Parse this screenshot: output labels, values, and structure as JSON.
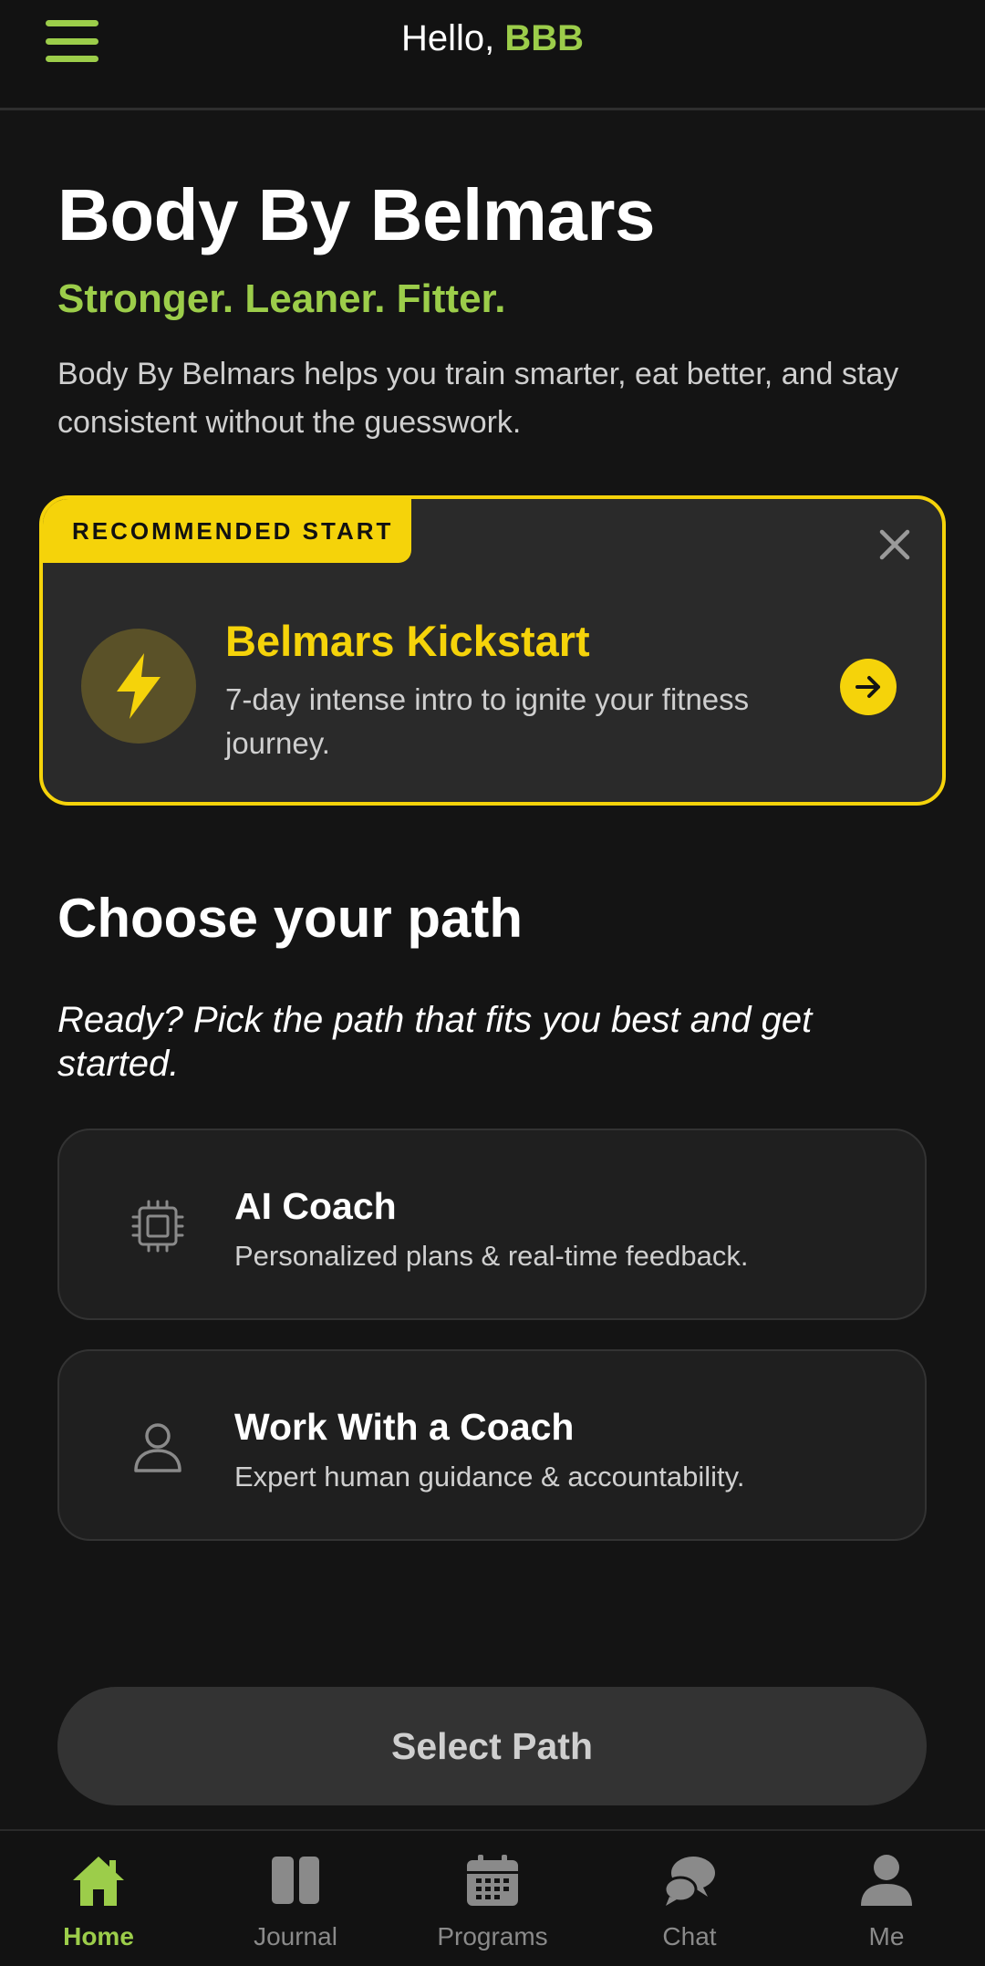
{
  "header": {
    "greeting_prefix": "Hello,",
    "user_name": "BBB"
  },
  "hero": {
    "title": "Body By Belmars",
    "tagline": "Stronger. Leaner. Fitter.",
    "description": "Body By Belmars helps you train smarter, eat better, and stay consistent without the guesswork."
  },
  "recommended": {
    "badge": "RECOMMENDED START",
    "title": "Belmars Kickstart",
    "description": "7-day intense intro to ignite your fitness journey."
  },
  "paths": {
    "title": "Choose your path",
    "subtitle": "Ready? Pick the path that fits you best and get started.",
    "items": [
      {
        "title": "AI Coach",
        "description": "Personalized plans & real-time feedback."
      },
      {
        "title": "Work With a Coach",
        "description": "Expert human guidance & accountability."
      }
    ],
    "select_label": "Select Path"
  },
  "nav": {
    "items": [
      {
        "label": "Home",
        "icon": "home-icon"
      },
      {
        "label": "Journal",
        "icon": "journal-icon"
      },
      {
        "label": "Programs",
        "icon": "calendar-icon"
      },
      {
        "label": "Chat",
        "icon": "chat-icon"
      },
      {
        "label": "Me",
        "icon": "person-icon"
      }
    ]
  },
  "colors": {
    "accent_green": "#9ccd4a",
    "accent_yellow": "#f5d30a",
    "background": "#141414"
  }
}
